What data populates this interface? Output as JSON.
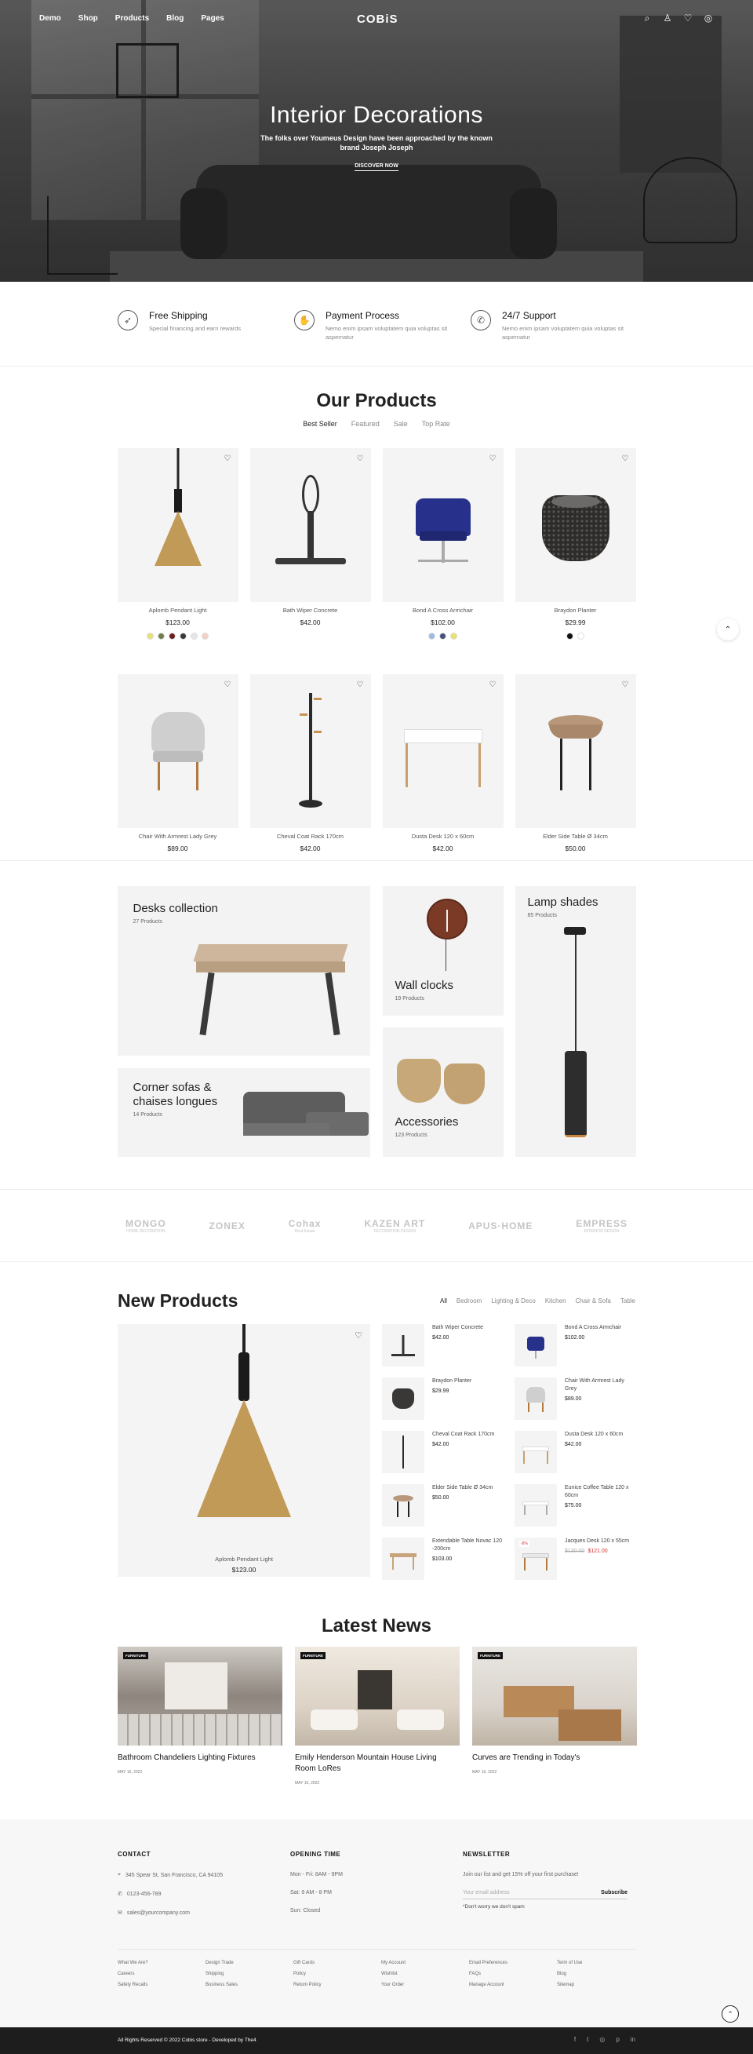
{
  "nav": {
    "links": [
      "Demo",
      "Shop",
      "Products",
      "Blog",
      "Pages"
    ],
    "logo": "COBiS",
    "icons": [
      "search-icon",
      "user-icon",
      "wishlist-icon",
      "cart-icon"
    ]
  },
  "hero": {
    "title": "Interior Decorations",
    "subtitle": "The folks over Youmeus Design have been approached by the known brand Joseph Joseph",
    "button": "DISCOVER NOW"
  },
  "features": [
    {
      "icon": "rocket-icon",
      "title": "Free Shipping",
      "text": "Special financing and earn rewards"
    },
    {
      "icon": "handshake-icon",
      "title": "Payment Process",
      "text": "Nemo enim ipsam voluptatem quia voluptas sit aspernatur"
    },
    {
      "icon": "phone-icon",
      "title": "24/7 Support",
      "text": "Nemo enim ipsam voluptatem quia voluptas sit aspernatur"
    }
  ],
  "our_products": {
    "title": "Our Products",
    "tabs": [
      "Best Seller",
      "Featured",
      "Sale",
      "Top Rate"
    ],
    "items": [
      {
        "name": "Aplomb Pendant Light",
        "price": "$123.00",
        "swatches": [
          "#e4e07a",
          "#6f7d4f",
          "#6a1f1f",
          "#3a3a3a",
          "#e5e5e5",
          "#f2d2c2"
        ]
      },
      {
        "name": "Bath Wiper Concrete",
        "price": "$42.00",
        "swatches": []
      },
      {
        "name": "Bond A Cross Armchair",
        "price": "$102.00",
        "swatches": [
          "#9bbbe0",
          "#46507a",
          "#e8e36a"
        ]
      },
      {
        "name": "Braydon Planter",
        "price": "$29.99",
        "swatches": [
          "#111111",
          "#ffffff"
        ]
      },
      {
        "name": "Chair With Armrest Lady Grey",
        "price": "$89.00",
        "swatches": []
      },
      {
        "name": "Cheval Coat Rack 170cm",
        "price": "$42.00",
        "swatches": []
      },
      {
        "name": "Dusta Desk 120 x 60cm",
        "price": "$42.00",
        "swatches": []
      },
      {
        "name": "Elder Side Table Ø 34cm",
        "price": "$50.00",
        "swatches": []
      }
    ]
  },
  "collections": {
    "desks": {
      "title": "Desks collection",
      "count": "27 Products"
    },
    "sofas": {
      "title": "Corner sofas & chaises longues",
      "count": "14 Products"
    },
    "clocks": {
      "title": "Wall clocks",
      "count": "19 Products"
    },
    "accessories": {
      "title": "Accessories",
      "count": "123 Products"
    },
    "lamps": {
      "title": "Lamp shades",
      "count": "85 Products"
    }
  },
  "brands": [
    {
      "name": "MONGO",
      "tag": "HOME DECORATION"
    },
    {
      "name": "ZONEX",
      "tag": ""
    },
    {
      "name": "Cohax",
      "tag": "Real Estate"
    },
    {
      "name": "KAZEN ART",
      "tag": "DECORATION DESIGN"
    },
    {
      "name": "APUS·HOME",
      "tag": ""
    },
    {
      "name": "EMPRESS",
      "tag": "INTERIOR DESIGN"
    }
  ],
  "new_products": {
    "title": "New Products",
    "tabs": [
      "All",
      "Bedroom",
      "Lighting & Deco",
      "Kitchen",
      "Chair & Sofa",
      "Table"
    ],
    "featured": {
      "name": "Aplomb Pendant Light",
      "price": "$123.00"
    },
    "items": [
      {
        "name": "Bath Wiper Concrete",
        "price": "$42.00",
        "old": ""
      },
      {
        "name": "Bond A Cross Armchair",
        "price": "$102.00",
        "old": ""
      },
      {
        "name": "Braydon Planter",
        "price": "$29.99",
        "old": ""
      },
      {
        "name": "Chair With Armrest Lady Grey",
        "price": "$89.00",
        "old": ""
      },
      {
        "name": "Cheval Coat Rack 170cm",
        "price": "$42.00",
        "old": ""
      },
      {
        "name": "Dusta Desk 120 x 60cm",
        "price": "$42.00",
        "old": ""
      },
      {
        "name": "Elder Side Table Ø 34cm",
        "price": "$50.00",
        "old": ""
      },
      {
        "name": "Eunice Coffee Table 120 x 60cm",
        "price": "$75.00",
        "old": ""
      },
      {
        "name": "Extendable Table Novac 120 -200cm",
        "price": "$103.00",
        "old": ""
      },
      {
        "name": "Jacques Desk 120 x 55cm",
        "price": "$121.00",
        "old": "$130.00",
        "badge": "-8%"
      }
    ]
  },
  "news": {
    "title": "Latest News",
    "posts": [
      {
        "tag": "FURNITURE",
        "title": "Bathroom Chandeliers Lighting Fixtures",
        "date": "MAY 16, 2022"
      },
      {
        "tag": "FURNITURE",
        "title": "Emily Henderson Mountain House Living Room LoRes",
        "date": "MAY 16, 2022"
      },
      {
        "tag": "FURNITURE",
        "title": "Curves are Trending in Today's",
        "date": "MAY 16, 2022"
      }
    ]
  },
  "footer": {
    "contact": {
      "title": "CONTACT",
      "address": "345 Spear St, San Francisco, CA 94105",
      "phone": "0123-456-789",
      "email": "sales@yourcompany.com"
    },
    "hours": {
      "title": "OPENING TIME",
      "lines": [
        "Mon - Fri: 8AM - 9PM",
        "Sat: 9 AM - 8 PM",
        "Sun: Closed"
      ]
    },
    "newsletter": {
      "title": "NEWSLETTER",
      "text": "Join our list and get 15% off your first purchase!",
      "placeholder": "Your email address",
      "button": "Subscribe",
      "note": "*Don't worry we don't spam"
    },
    "links": [
      "What We Are?",
      "Design Trade",
      "Gift Cards",
      "My Account",
      "Email Preferences",
      "Term of Use",
      "Careers",
      "Shipping",
      "Policy",
      "Wishlist",
      "FAQs",
      "Blog",
      "Safety Recalls",
      "Business Sales",
      "Return Policy",
      "Your Order",
      "Manage Account",
      "Sitemap"
    ],
    "copyright": "All Rights Reserved © 2022 Cobis store - Developed by The4",
    "social": [
      "facebook-icon",
      "twitter-icon",
      "instagram-icon",
      "pinterest-icon",
      "linkedin-icon"
    ]
  }
}
